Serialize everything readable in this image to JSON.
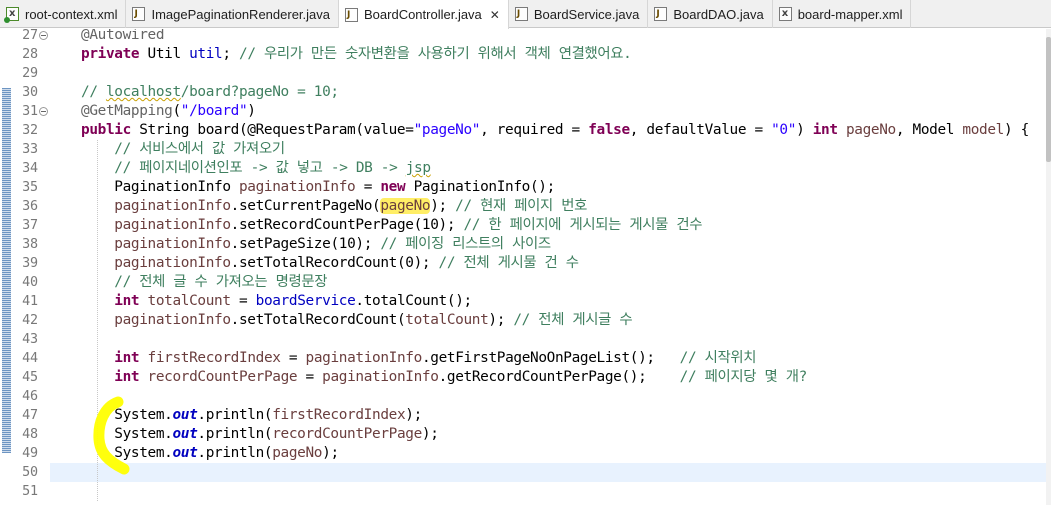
{
  "tabs": [
    {
      "label": "root-context.xml",
      "icon": "xml-file-icon",
      "active": false
    },
    {
      "label": "ImagePaginationRenderer.java",
      "icon": "java-file-icon",
      "active": false
    },
    {
      "label": "BoardController.java",
      "icon": "java-file-icon",
      "active": true
    },
    {
      "label": "BoardService.java",
      "icon": "java-file-icon",
      "active": false
    },
    {
      "label": "BoardDAO.java",
      "icon": "java-file-icon",
      "active": false
    },
    {
      "label": "board-mapper.xml",
      "icon": "xml-file-icon",
      "active": false
    }
  ],
  "close_glyph": "✕",
  "editor": {
    "current_line": "50",
    "lines": [
      {
        "n": "27",
        "fold": true,
        "t": [
          [
            "an",
            "@Autowired"
          ]
        ]
      },
      {
        "n": "28",
        "fold": false,
        "t": [
          [
            "kw",
            "private"
          ],
          [
            "tx",
            " Util "
          ],
          [
            "fd",
            "util"
          ],
          [
            "tx",
            "; "
          ],
          [
            "cm",
            "// 우리가 만든 숫자변환을 사용하기 위해서 객체 연결했어요."
          ]
        ]
      },
      {
        "n": "29",
        "fold": false,
        "t": []
      },
      {
        "n": "30",
        "fold": false,
        "t": [
          [
            "cm",
            "// "
          ],
          [
            "cm wavy",
            "localhost"
          ],
          [
            "cm",
            "/board?pageNo = 10;"
          ]
        ]
      },
      {
        "n": "31",
        "fold": true,
        "t": [
          [
            "an",
            "@GetMapping"
          ],
          [
            "tx",
            "("
          ],
          [
            "st",
            "\"/board\""
          ],
          [
            "tx",
            ")"
          ]
        ]
      },
      {
        "n": "32",
        "fold": false,
        "t": [
          [
            "kw",
            "public"
          ],
          [
            "tx",
            " String board(@RequestParam(value="
          ],
          [
            "st",
            "\"pageNo\""
          ],
          [
            "tx",
            ", required = "
          ],
          [
            "kw",
            "false"
          ],
          [
            "tx",
            ", defaultValue = "
          ],
          [
            "st",
            "\"0\""
          ],
          [
            "tx",
            ") "
          ],
          [
            "kw",
            "int"
          ],
          [
            "tx",
            " "
          ],
          [
            "vr",
            "pageNo"
          ],
          [
            "tx",
            ", Model "
          ],
          [
            "vr",
            "model"
          ],
          [
            "tx",
            ") {"
          ]
        ]
      },
      {
        "n": "33",
        "fold": false,
        "t": [
          [
            "tx",
            "    "
          ],
          [
            "cm",
            "// 서비스에서 값 가져오기"
          ]
        ]
      },
      {
        "n": "34",
        "fold": false,
        "t": [
          [
            "tx",
            "    "
          ],
          [
            "cm",
            "// 페이지네이션인포 -> 값 넣고 -> DB -> "
          ],
          [
            "cm wavy",
            "jsp"
          ]
        ]
      },
      {
        "n": "35",
        "fold": false,
        "t": [
          [
            "tx",
            "    PaginationInfo "
          ],
          [
            "vr",
            "paginationInfo"
          ],
          [
            "tx",
            " = "
          ],
          [
            "kw",
            "new"
          ],
          [
            "tx",
            " PaginationInfo();"
          ]
        ]
      },
      {
        "n": "36",
        "fold": false,
        "t": [
          [
            "tx",
            "    "
          ],
          [
            "vr",
            "paginationInfo"
          ],
          [
            "tx",
            ".setCurrentPageNo("
          ],
          [
            "vr hl",
            "pageNo"
          ],
          [
            "tx",
            "); "
          ],
          [
            "cm",
            "// 현재 페이지 번호"
          ]
        ]
      },
      {
        "n": "37",
        "fold": false,
        "t": [
          [
            "tx",
            "    "
          ],
          [
            "vr",
            "paginationInfo"
          ],
          [
            "tx",
            ".setRecordCountPerPage(10); "
          ],
          [
            "cm",
            "// 한 페이지에 게시되는 게시물 건수"
          ]
        ]
      },
      {
        "n": "38",
        "fold": false,
        "t": [
          [
            "tx",
            "    "
          ],
          [
            "vr",
            "paginationInfo"
          ],
          [
            "tx",
            ".setPageSize(10); "
          ],
          [
            "cm",
            "// 페이징 리스트의 사이즈"
          ]
        ]
      },
      {
        "n": "39",
        "fold": false,
        "t": [
          [
            "tx",
            "    "
          ],
          [
            "vr",
            "paginationInfo"
          ],
          [
            "tx",
            ".setTotalRecordCount(0); "
          ],
          [
            "cm",
            "// 전체 게시물 건 수"
          ]
        ]
      },
      {
        "n": "40",
        "fold": false,
        "t": [
          [
            "tx",
            "    "
          ],
          [
            "cm",
            "// 전체 글 수 가져오는 명령문장"
          ]
        ]
      },
      {
        "n": "41",
        "fold": false,
        "t": [
          [
            "tx",
            "    "
          ],
          [
            "kw",
            "int"
          ],
          [
            "tx",
            " "
          ],
          [
            "vr",
            "totalCount"
          ],
          [
            "tx",
            " = "
          ],
          [
            "fd",
            "boardService"
          ],
          [
            "tx",
            ".totalCount();"
          ]
        ]
      },
      {
        "n": "42",
        "fold": false,
        "t": [
          [
            "tx",
            "    "
          ],
          [
            "vr",
            "paginationInfo"
          ],
          [
            "tx",
            ".setTotalRecordCount("
          ],
          [
            "vr",
            "totalCount"
          ],
          [
            "tx",
            "); "
          ],
          [
            "cm",
            "// 전체 게시글 수"
          ]
        ]
      },
      {
        "n": "43",
        "fold": false,
        "t": []
      },
      {
        "n": "44",
        "fold": false,
        "t": [
          [
            "tx",
            "    "
          ],
          [
            "kw",
            "int"
          ],
          [
            "tx",
            " "
          ],
          [
            "vr",
            "firstRecordIndex"
          ],
          [
            "tx",
            " = "
          ],
          [
            "vr",
            "paginationInfo"
          ],
          [
            "tx",
            ".getFirstPageNoOnPageList();   "
          ],
          [
            "cm",
            "// 시작위치"
          ]
        ]
      },
      {
        "n": "45",
        "fold": false,
        "t": [
          [
            "tx",
            "    "
          ],
          [
            "kw",
            "int"
          ],
          [
            "tx",
            " "
          ],
          [
            "vr",
            "recordCountPerPage"
          ],
          [
            "tx",
            " = "
          ],
          [
            "vr",
            "paginationInfo"
          ],
          [
            "tx",
            ".getRecordCountPerPage();    "
          ],
          [
            "cm",
            "// 페이지당 몇 개?"
          ]
        ]
      },
      {
        "n": "46",
        "fold": false,
        "t": []
      },
      {
        "n": "47",
        "fold": false,
        "t": [
          [
            "tx",
            "    System."
          ],
          [
            "sf",
            "out"
          ],
          [
            "tx",
            ".println("
          ],
          [
            "vr",
            "firstRecordIndex"
          ],
          [
            "tx",
            ");"
          ]
        ]
      },
      {
        "n": "48",
        "fold": false,
        "t": [
          [
            "tx",
            "    System."
          ],
          [
            "sf",
            "out"
          ],
          [
            "tx",
            ".println("
          ],
          [
            "vr",
            "recordCountPerPage"
          ],
          [
            "tx",
            ");"
          ]
        ]
      },
      {
        "n": "49",
        "fold": false,
        "t": [
          [
            "tx",
            "    System."
          ],
          [
            "sf",
            "out"
          ],
          [
            "tx",
            ".println("
          ],
          [
            "vr",
            "pageNo"
          ],
          [
            "tx",
            ");"
          ]
        ]
      },
      {
        "n": "50",
        "fold": false,
        "t": []
      },
      {
        "n": "51",
        "fold": false,
        "t": []
      }
    ]
  },
  "colors": {
    "keyword": "#7f0055",
    "comment": "#3f7f5f",
    "string": "#2a00ff",
    "field": "#0000c0",
    "local_variable": "#6a3e3e",
    "highlight": "#ffee66",
    "current_line": "#e8f2fe",
    "annotation_marker": "#ffff00"
  }
}
